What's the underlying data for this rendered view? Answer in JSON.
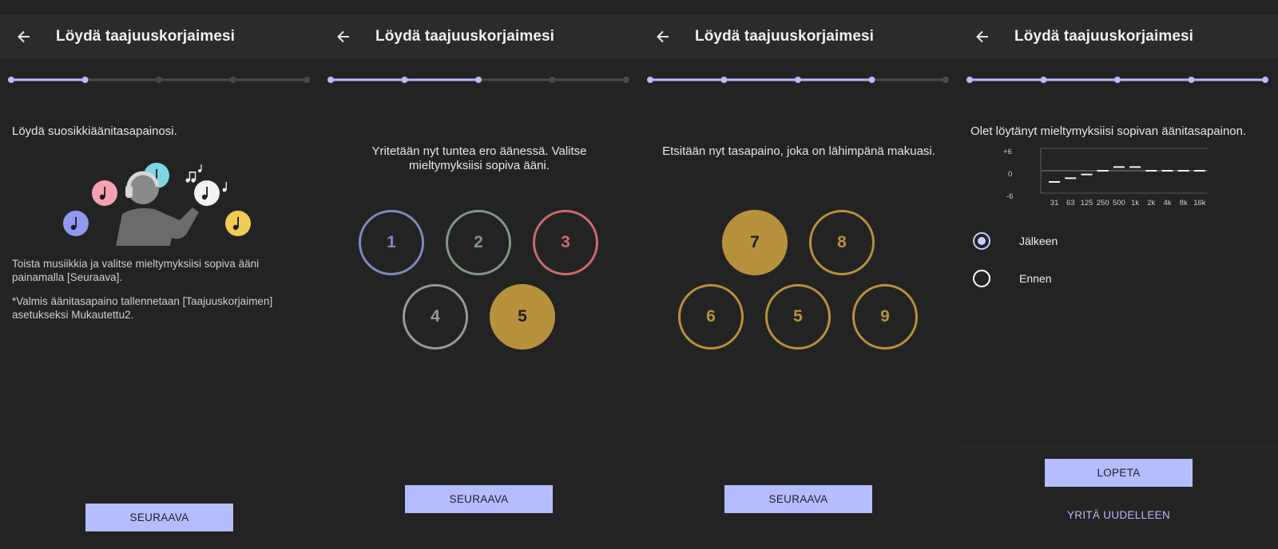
{
  "app": {
    "title": "Löydä taajuuskorjaimesi"
  },
  "colors": {
    "accent": "#b5bdff",
    "gold": "#b8913c",
    "track": "#4a4a4a"
  },
  "steps_total": 5,
  "screens": [
    {
      "progress_step": 2,
      "intro": "Löydä suosikkiäänitasapainosi.",
      "illustration": "person-with-headphones-and-music-notes",
      "instructions": "Toista musiikkia ja valitse mieltymyksiisi sopiva ääni painamalla [Seuraava].",
      "note": "*Valmis äänitasapaino tallennetaan [Taajuuskorjaimen] asetukseksi Mukautettu2.",
      "next_label": "SEURAAVA"
    },
    {
      "progress_step": 3,
      "prompt": "Yritetään nyt tuntea ero äänessä. Valitse mieltymyksiisi sopiva ääni.",
      "options": [
        {
          "label": "1",
          "color": "#7f8bc0",
          "selected": false
        },
        {
          "label": "2",
          "color": "#7e9a82",
          "selected": false
        },
        {
          "label": "3",
          "color": "#cf6b6b",
          "selected": false
        },
        {
          "label": "4",
          "color": "#9a9a9a",
          "selected": false
        },
        {
          "label": "5",
          "color": "#b8913c",
          "selected": true
        }
      ],
      "next_label": "SEURAAVA"
    },
    {
      "progress_step": 4,
      "prompt": "Etsitään nyt tasapaino, joka on lähimpänä makuasi.",
      "options": [
        {
          "label": "7",
          "color": "#b8913c",
          "selected": true
        },
        {
          "label": "8",
          "color": "#b8913c",
          "selected": false
        },
        {
          "label": "6",
          "color": "#b8913c",
          "selected": false
        },
        {
          "label": "5",
          "color": "#b8913c",
          "selected": false
        },
        {
          "label": "9",
          "color": "#b8913c",
          "selected": false
        }
      ],
      "next_label": "SEURAAVA"
    },
    {
      "progress_step": 5,
      "result": "Olet löytänyt mieltymyksiisi sopivan äänitasapainon.",
      "eq": {
        "y_ticks": [
          "+6",
          "0",
          "-6"
        ],
        "ylim": [
          -6,
          6
        ],
        "bands": [
          "31",
          "63",
          "125",
          "250",
          "500",
          "1k",
          "2k",
          "4k",
          "8k",
          "16k"
        ],
        "values": [
          -3,
          -2,
          -1,
          0,
          1,
          1,
          0,
          0,
          0,
          0
        ]
      },
      "radios": [
        {
          "label": "Jälkeen",
          "checked": true
        },
        {
          "label": "Ennen",
          "checked": false
        }
      ],
      "finish_label": "LOPETA",
      "retry_label": "YRITÄ UUDELLEEN"
    }
  ]
}
